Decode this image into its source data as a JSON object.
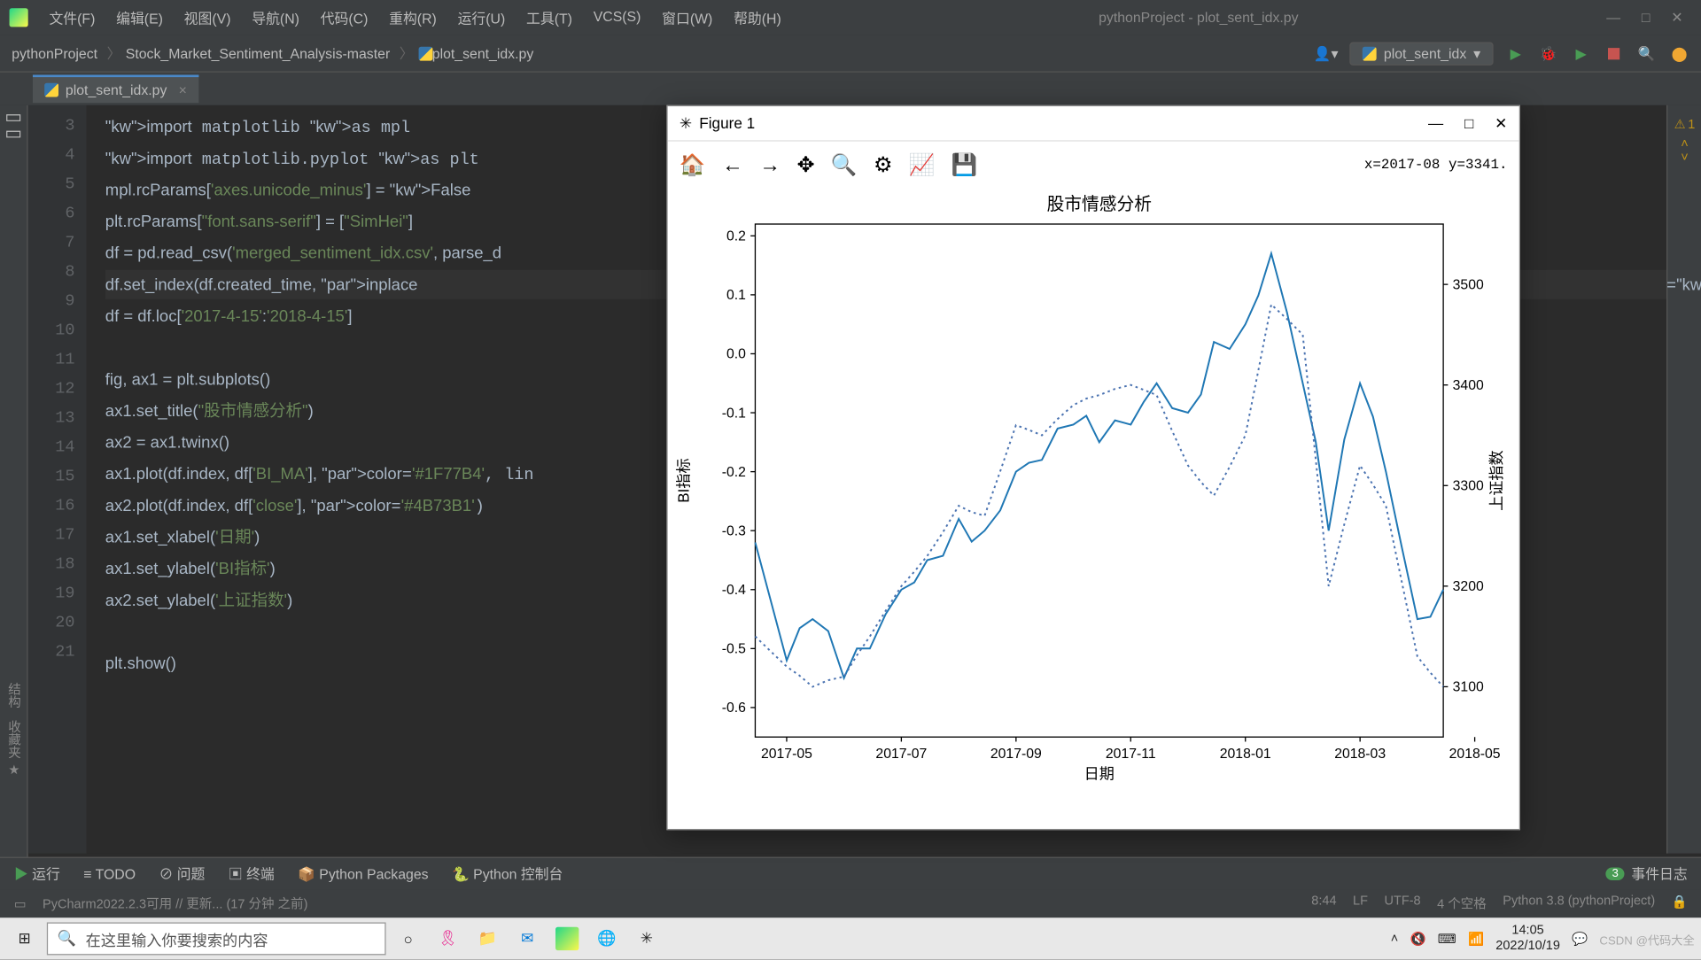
{
  "window_title": "pythonProject - plot_sent_idx.py",
  "menus": [
    "文件(F)",
    "编辑(E)",
    "视图(V)",
    "导航(N)",
    "代码(C)",
    "重构(R)",
    "运行(U)",
    "工具(T)",
    "VCS(S)",
    "窗口(W)",
    "帮助(H)"
  ],
  "breadcrumb": [
    "pythonProject",
    "Stock_Market_Sentiment_Analysis-master",
    "plot_sent_idx.py"
  ],
  "run_config": "plot_sent_idx",
  "tab_name": "plot_sent_idx.py",
  "problems_count": "1",
  "code_lines": [
    {
      "n": "3",
      "raw": "import matplotlib as mpl"
    },
    {
      "n": "4",
      "raw": "import matplotlib.pyplot as plt"
    },
    {
      "n": "5",
      "raw": "mpl.rcParams['axes.unicode_minus'] = False"
    },
    {
      "n": "6",
      "raw": "plt.rcParams[\"font.sans-serif\"] = [\"SimHei\"]"
    },
    {
      "n": "7",
      "raw": "df = pd.read_csv('merged_sentiment_idx.csv', parse_d"
    },
    {
      "n": "8",
      "raw": "df.set_index(df.created_time, inplace=True)"
    },
    {
      "n": "9",
      "raw": "df = df.loc['2017-4-15':'2018-4-15']"
    },
    {
      "n": "10",
      "raw": ""
    },
    {
      "n": "11",
      "raw": "fig, ax1 = plt.subplots()"
    },
    {
      "n": "12",
      "raw": "ax1.set_title(\"股市情感分析\")"
    },
    {
      "n": "13",
      "raw": "ax2 = ax1.twinx()"
    },
    {
      "n": "14",
      "raw": "ax1.plot(df.index, df['BI_MA'], color='#1F77B4', lin"
    },
    {
      "n": "15",
      "raw": "ax2.plot(df.index, df['close'], color='#4B73B1')"
    },
    {
      "n": "16",
      "raw": "ax1.set_xlabel('日期')"
    },
    {
      "n": "17",
      "raw": "ax1.set_ylabel('BI指标')"
    },
    {
      "n": "18",
      "raw": "ax2.set_ylabel('上证指数')"
    },
    {
      "n": "19",
      "raw": ""
    },
    {
      "n": "20",
      "raw": "plt.show()"
    },
    {
      "n": "21",
      "raw": ""
    }
  ],
  "figure": {
    "title": "Figure 1",
    "coord": "x=2017-08  y=3341."
  },
  "chart_data": {
    "type": "line",
    "title": "股市情感分析",
    "xlabel": "日期",
    "ylabel_left": "BI指标",
    "ylabel_right": "上证指数",
    "x_ticks": [
      "2017-05",
      "2017-07",
      "2017-09",
      "2017-11",
      "2018-01",
      "2018-03",
      "2018-05"
    ],
    "y1_ticks": [
      -0.6,
      -0.5,
      -0.4,
      -0.3,
      -0.2,
      -0.1,
      0.0,
      0.1,
      0.2
    ],
    "y2_ticks": [
      3100,
      3200,
      3300,
      3400,
      3500
    ],
    "y1_range": [
      -0.65,
      0.22
    ],
    "y2_range": [
      3050,
      3560
    ],
    "series": [
      {
        "name": "BI_MA",
        "style": "solid",
        "color": "#1F77B4",
        "axis": "left",
        "x": [
          "2017-04-15",
          "2017-05-01",
          "2017-05-15",
          "2017-06-01",
          "2017-06-15",
          "2017-07-01",
          "2017-07-15",
          "2017-08-01",
          "2017-08-15",
          "2017-09-01",
          "2017-09-15",
          "2017-10-01",
          "2017-10-15",
          "2017-11-01",
          "2017-11-15",
          "2017-12-01",
          "2017-12-15",
          "2018-01-01",
          "2018-01-15",
          "2018-02-01",
          "2018-02-15",
          "2018-03-01",
          "2018-03-15",
          "2018-04-01",
          "2018-04-15"
        ],
        "y": [
          -0.32,
          -0.52,
          -0.45,
          -0.55,
          -0.5,
          -0.4,
          -0.35,
          -0.28,
          -0.3,
          -0.2,
          -0.18,
          -0.12,
          -0.15,
          -0.12,
          -0.05,
          -0.1,
          0.02,
          0.05,
          0.17,
          -0.05,
          -0.3,
          -0.05,
          -0.2,
          -0.45,
          -0.4
        ]
      },
      {
        "name": "close",
        "style": "dotted",
        "color": "#4B73B1",
        "axis": "right",
        "x": [
          "2017-04-15",
          "2017-05-01",
          "2017-05-15",
          "2017-06-01",
          "2017-06-15",
          "2017-07-01",
          "2017-07-15",
          "2017-08-01",
          "2017-08-15",
          "2017-09-01",
          "2017-09-15",
          "2017-10-01",
          "2017-10-15",
          "2017-11-01",
          "2017-11-15",
          "2017-12-01",
          "2017-12-15",
          "2018-01-01",
          "2018-01-15",
          "2018-02-01",
          "2018-02-15",
          "2018-03-01",
          "2018-03-15",
          "2018-04-01",
          "2018-04-15"
        ],
        "y": [
          3150,
          3120,
          3100,
          3110,
          3150,
          3200,
          3230,
          3280,
          3270,
          3360,
          3350,
          3380,
          3390,
          3400,
          3390,
          3320,
          3290,
          3350,
          3480,
          3450,
          3200,
          3320,
          3280,
          3130,
          3100
        ]
      }
    ]
  },
  "bottom_tools": [
    "运行",
    "TODO",
    "问题",
    "终端",
    "Python Packages",
    "Python 控制台"
  ],
  "event_log": "事件日志",
  "event_badge": "3",
  "status_left": "PyCharm2022.2.3可用 // 更新... (17 分钟 之前)",
  "status_right": [
    "8:44",
    "LF",
    "UTF-8",
    "4 个空格",
    "Python 3.8 (pythonProject)"
  ],
  "taskbar_search_placeholder": "在这里输入你要搜索的内容",
  "clock_time": "14:05",
  "clock_date": "2022/10/19",
  "left_rail_labels": [
    "结构",
    "收藏夹"
  ],
  "watermark": "CSDN @代码大全"
}
